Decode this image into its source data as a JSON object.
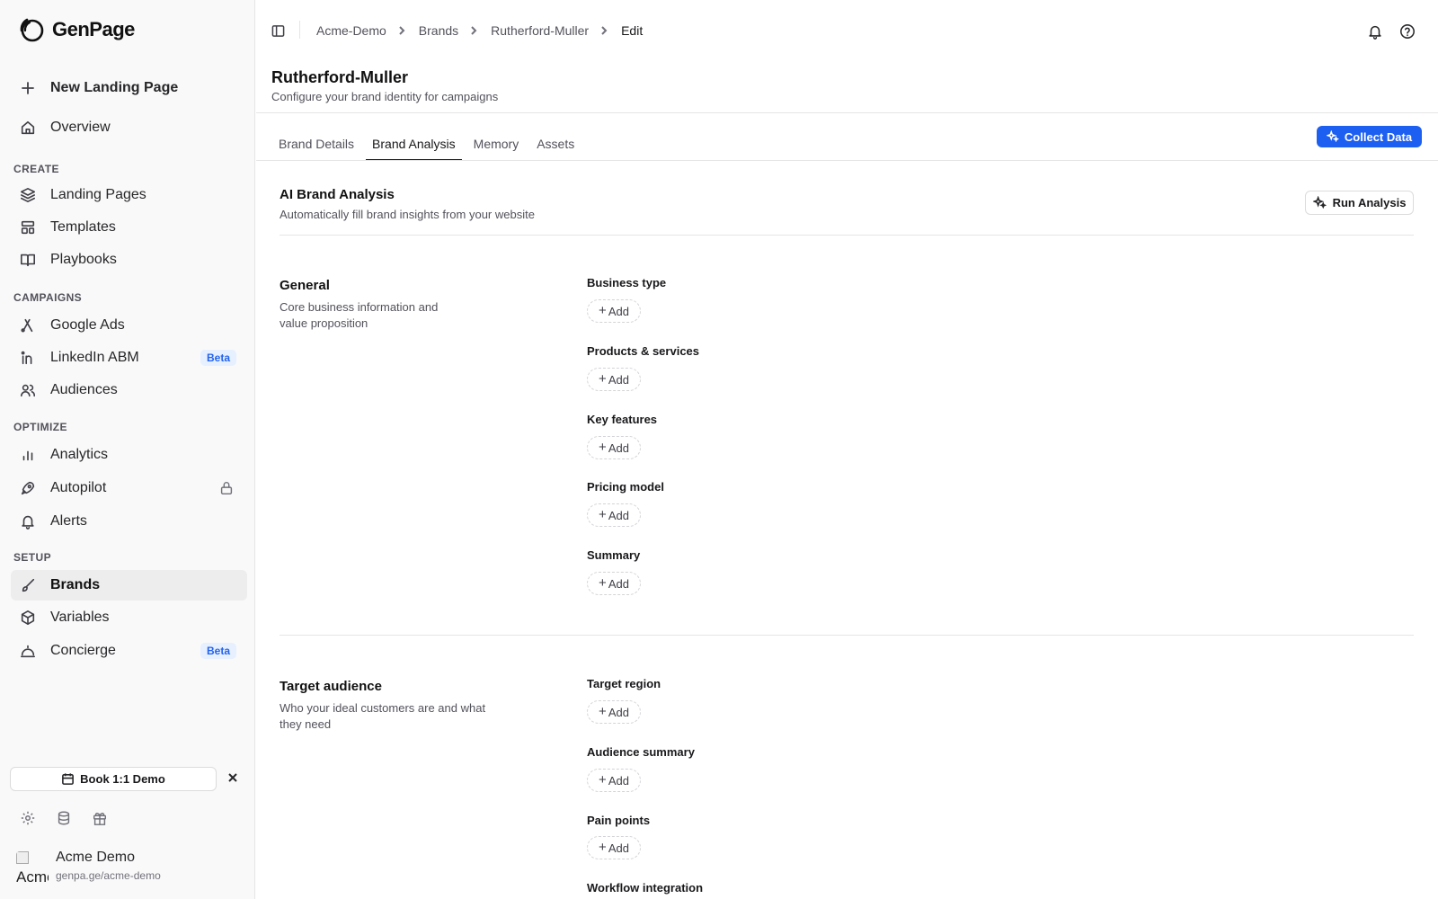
{
  "app": {
    "name": "GenPage"
  },
  "sidebar": {
    "new_label": "New Landing Page",
    "overview": "Overview",
    "sections": {
      "create": "CREATE",
      "campaigns": "CAMPAIGNS",
      "optimize": "OPTIMIZE",
      "setup": "SETUP"
    },
    "items": {
      "landing_pages": "Landing Pages",
      "templates": "Templates",
      "playbooks": "Playbooks",
      "google_ads": "Google Ads",
      "linkedin_abm": "LinkedIn ABM",
      "audiences": "Audiences",
      "analytics": "Analytics",
      "autopilot": "Autopilot",
      "alerts": "Alerts",
      "brands": "Brands",
      "variables": "Variables",
      "concierge": "Concierge"
    },
    "beta_label": "Beta",
    "active_item": "brands",
    "demo_button": "Book 1:1 Demo",
    "account": {
      "name": "Acme Demo",
      "url": "genpa.ge/acme-demo",
      "avatar_alt": "Acme"
    }
  },
  "breadcrumb": [
    "Acme-Demo",
    "Brands",
    "Rutherford-Muller",
    "Edit"
  ],
  "page": {
    "title": "Rutherford-Muller",
    "subtitle": "Configure your brand identity for campaigns"
  },
  "tabs": [
    "Brand Details",
    "Brand Analysis",
    "Memory",
    "Assets"
  ],
  "active_tab": "Brand Analysis",
  "collect_button": "Collect Data",
  "analysis": {
    "title": "AI Brand Analysis",
    "subtitle": "Automatically fill brand insights from your website",
    "run_button": "Run Analysis"
  },
  "add_label": "Add",
  "general": {
    "title": "General",
    "desc_line1": "Core business information and",
    "desc_line2": "value proposition",
    "fields": [
      "Business type",
      "Products & services",
      "Key features",
      "Pricing model",
      "Summary"
    ]
  },
  "target_audience": {
    "title": "Target audience",
    "desc_line1": "Who your ideal customers are and what",
    "desc_line2": "they need",
    "fields": [
      "Target region",
      "Audience summary",
      "Pain points",
      "Workflow integration"
    ]
  },
  "colors": {
    "accent": "#1d5ff0",
    "beta_bg": "#e6f0ff",
    "beta_text": "#2563eb",
    "sidebar_bg": "#f9f9f9"
  }
}
